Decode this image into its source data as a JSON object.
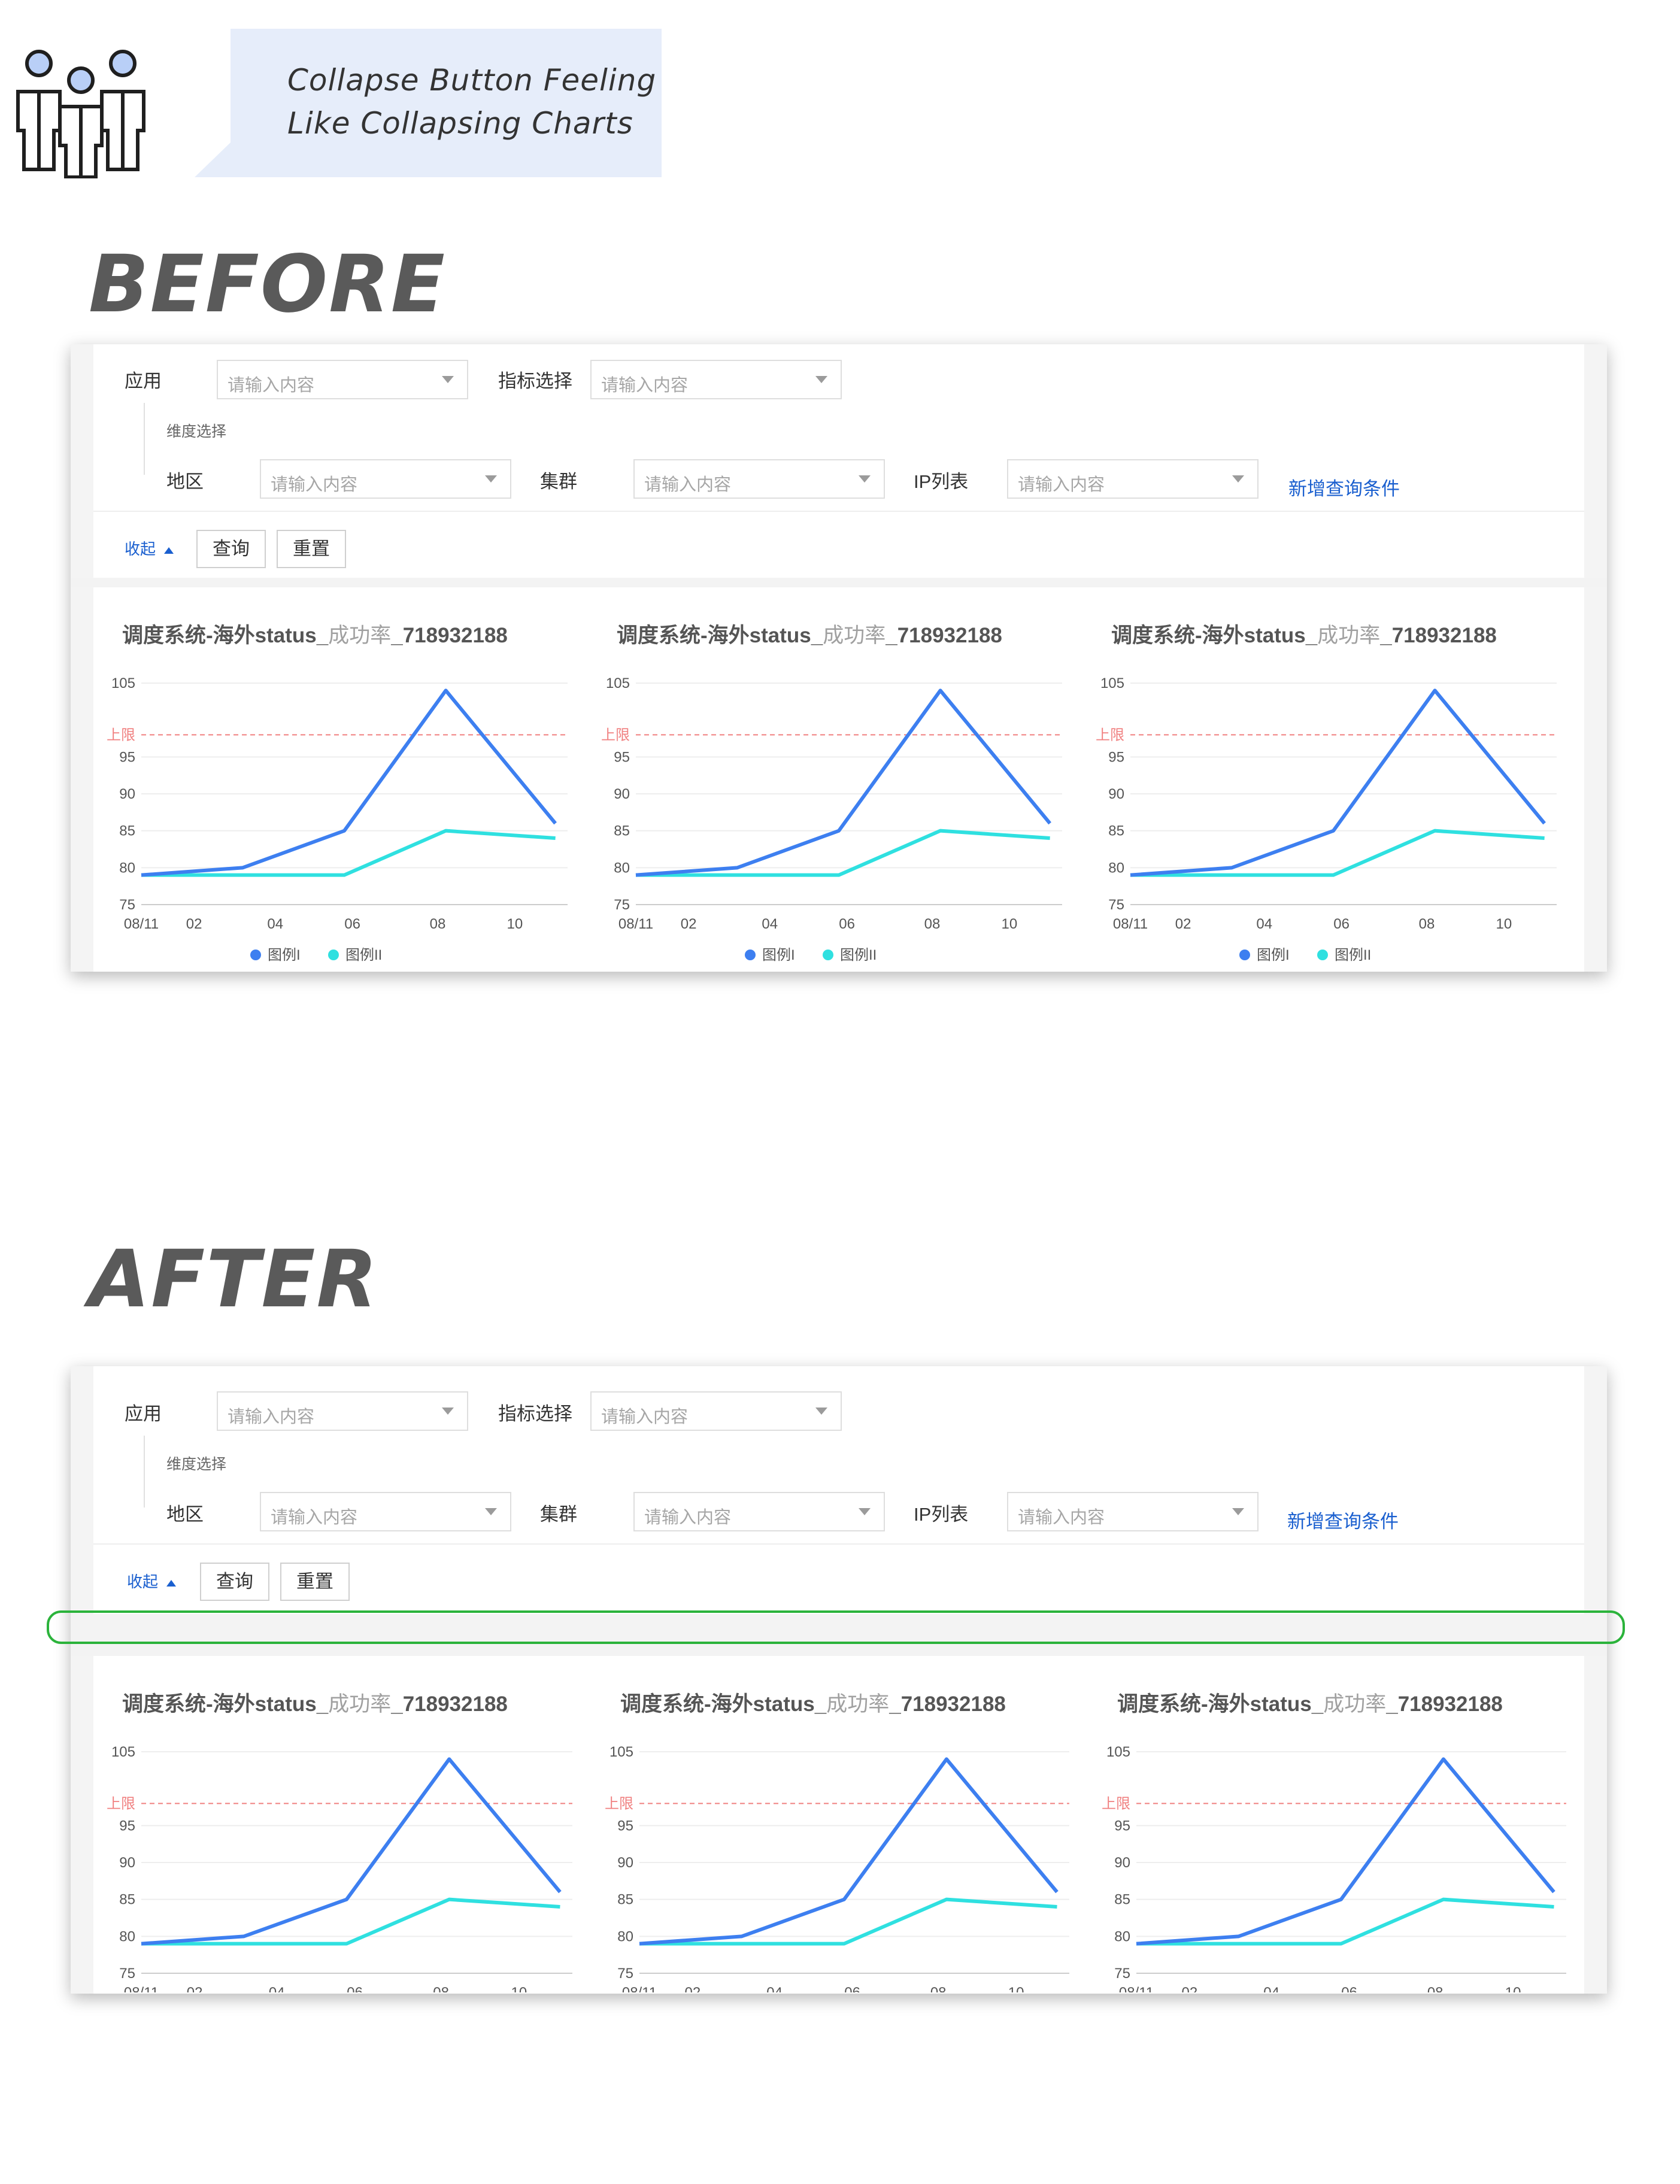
{
  "callout": {
    "line1": "Collapse Button Feeling",
    "line2": "Like Collapsing Charts"
  },
  "sections": {
    "before": "BEFORE",
    "after": "AFTER"
  },
  "form": {
    "app_label": "应用",
    "metric_label": "指标选择",
    "dimension_label": "维度选择",
    "region_label": "地区",
    "cluster_label": "集群",
    "ip_label": "IP列表",
    "placeholder": "请输入内容",
    "add_condition": "新增查询条件",
    "collapse": "收起",
    "query": "查询",
    "reset": "重置"
  },
  "chart_card": {
    "title_main": "调度系统-海外status_",
    "title_muted": "成功率",
    "title_tail": "_718932188"
  },
  "colors": {
    "series1": "#3d7ff0",
    "series2": "#2fe0e0",
    "limit": "#f08080",
    "accent": "#1a5fcf",
    "highlight": "#2bb33b"
  },
  "icons": [
    "people-group-icon",
    "dropdown-caret-icon",
    "collapse-up-icon"
  ],
  "chart_data": [
    {
      "type": "line",
      "x": [
        "08/11",
        "",
        "02",
        "",
        "04",
        "",
        "06",
        "",
        "08",
        "",
        "10",
        ""
      ],
      "x_ticks": [
        "08/11",
        "02",
        "04",
        "06",
        "08",
        "10"
      ],
      "series": [
        {
          "name": "图例I",
          "x_pos": [
            0,
            2.5,
            5,
            7.5,
            10.2
          ],
          "values": [
            79,
            80,
            85,
            104,
            86
          ]
        },
        {
          "name": "图例II",
          "x_pos": [
            0,
            2.5,
            5,
            7.5,
            10.2
          ],
          "values": [
            79,
            79,
            79,
            85,
            84
          ]
        }
      ],
      "y_ticks": [
        75,
        80,
        85,
        90,
        95,
        105
      ],
      "ylim": [
        75,
        105
      ],
      "limit_line": {
        "label": "上限",
        "value": 98
      },
      "legend": "bottom-center",
      "grid": true
    }
  ]
}
